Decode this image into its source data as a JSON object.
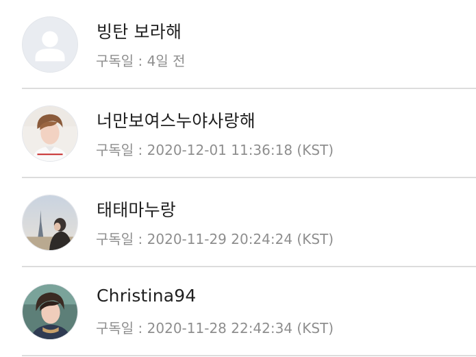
{
  "subscribers": [
    {
      "name": "빙탄 보라해",
      "date_label": "구독일",
      "separator": " : ",
      "date_value": "4일 전",
      "avatar_icon": "default-user-icon"
    },
    {
      "name": "너만보여스누야사랑해",
      "date_label": "구독일",
      "separator": " : ",
      "date_value": "2020-12-01 11:36:18 (KST)",
      "avatar_icon": "profile-photo"
    },
    {
      "name": "태태마누랑",
      "date_label": "구독일",
      "separator": " : ",
      "date_value": "2020-11-29 20:24:24 (KST)",
      "avatar_icon": "profile-photo"
    },
    {
      "name": "Christina94",
      "date_label": "구독일",
      "separator": " : ",
      "date_value": "2020-11-28 22:42:34 (KST)",
      "avatar_icon": "profile-photo"
    }
  ],
  "colors": {
    "name_text": "#1f1f1f",
    "meta_text": "#8e8e8e",
    "divider": "#dcdcdc",
    "default_avatar_bg": "#e9ecf1",
    "default_avatar_fg": "#ffffff"
  }
}
